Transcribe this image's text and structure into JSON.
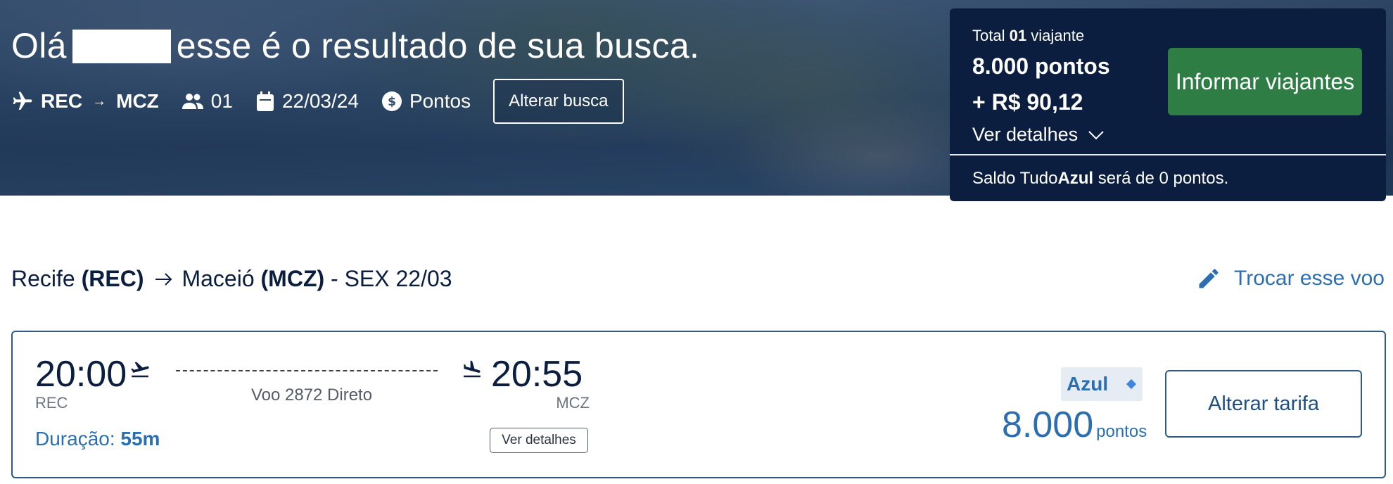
{
  "header": {
    "greeting_prefix": "Olá",
    "greeting_suffix": "esse é o resultado de sua busca.",
    "search": {
      "origin": "REC",
      "destination": "MCZ",
      "passengers": "01",
      "date": "22/03/24",
      "payment_mode": "Pontos",
      "alter_label": "Alterar busca"
    }
  },
  "summary": {
    "total_prefix": "Total",
    "total_count": "01",
    "total_suffix": "viajante",
    "points": "8.000 pontos",
    "money": "+ R$ 90,12",
    "details_label": "Ver detalhes",
    "inform_button": "Informar viajantes",
    "saldo_prefix": "Saldo Tudo",
    "saldo_brand": "Azul",
    "saldo_suffix": "será de 0 pontos."
  },
  "route": {
    "origin_city": "Recife",
    "origin_code": "(REC)",
    "destination_city": "Maceió",
    "destination_code": "(MCZ)",
    "date_text": "- SEX 22/03",
    "change_flight": "Trocar esse voo"
  },
  "flight": {
    "departure_time": "20:00",
    "departure_code": "REC",
    "arrival_time": "20:55",
    "arrival_code": "MCZ",
    "flight_info": "Voo 2872 Direto",
    "duration_label": "Duração:",
    "duration_value": "55m",
    "details_button": "Ver detalhes",
    "fare_class": "Azul",
    "price": "8.000",
    "price_unit": "pontos",
    "alter_fare": "Alterar tarifa"
  },
  "colors": {
    "navy": "#0b1e3f",
    "accent_blue": "#2c6fb1",
    "green": "#2e7d45"
  }
}
